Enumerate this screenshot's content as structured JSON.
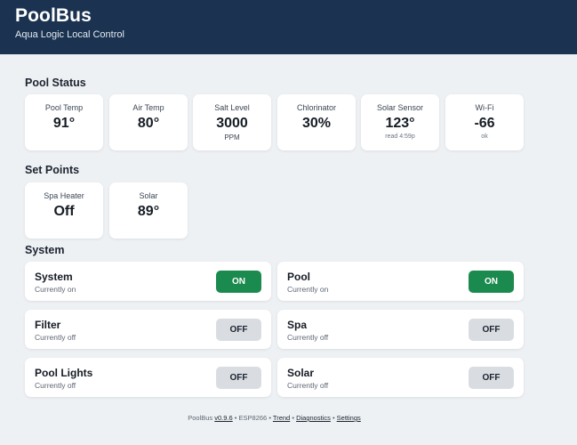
{
  "app": {
    "title": "PoolBus",
    "subtitle": "Aqua Logic Local Control"
  },
  "sections": {
    "status": "Pool Status",
    "setpoints": "Set Points",
    "system": "System"
  },
  "status": [
    {
      "label": "Pool Temp",
      "value": "91°"
    },
    {
      "label": "Air Temp",
      "value": "80°"
    },
    {
      "label": "Salt Level",
      "value": "3000",
      "note": "PPM"
    },
    {
      "label": "Chlorinator",
      "value": "30%"
    },
    {
      "label": "Solar Sensor",
      "value": "123°",
      "note": "read 4:59p"
    },
    {
      "label": "Wi-Fi",
      "value": "-66",
      "note": "ok"
    }
  ],
  "setpoints": [
    {
      "label": "Spa Heater",
      "value": "Off"
    },
    {
      "label": "Solar",
      "value": "89°"
    }
  ],
  "toggles": [
    {
      "name": "System",
      "state": "Currently on",
      "button": "ON",
      "on": true
    },
    {
      "name": "Pool",
      "state": "Currently on",
      "button": "ON",
      "on": true
    },
    {
      "name": "Filter",
      "state": "Currently off",
      "button": "OFF",
      "on": false
    },
    {
      "name": "Spa",
      "state": "Currently off",
      "button": "OFF",
      "on": false
    },
    {
      "name": "Pool Lights",
      "state": "Currently off",
      "button": "OFF",
      "on": false
    },
    {
      "name": "Solar",
      "state": "Currently off",
      "button": "OFF",
      "on": false
    }
  ],
  "footer": {
    "app": "PoolBus",
    "version": "v0.9.6",
    "sep1": "•",
    "device": "ESP8266",
    "sep2": "•",
    "trend": "Trend",
    "sep3": "•",
    "diagnostics": "Diagnostics",
    "sep4": "•",
    "settings": "Settings"
  },
  "colors": {
    "header": "#1b3350",
    "on": "#1b8a4e",
    "off": "#d9dde2",
    "background": "#eef1f4"
  }
}
